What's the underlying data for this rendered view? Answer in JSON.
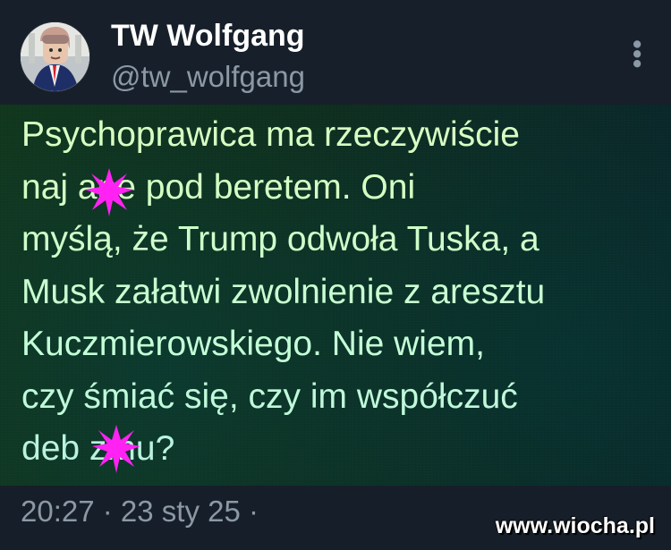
{
  "author": {
    "name": "TW Wolfgang",
    "handle": "@tw_wolfgang"
  },
  "post": {
    "lines": [
      "Psychoprawica ma rzeczywiście",
      "naj    ane pod beretem. Oni",
      "myślą, że Trump odwoła Tuska, a",
      "Musk załatwi zwolnienie z aresztu",
      "Kuczmierowskiego. Nie wiem,",
      "czy śmiać się, czy im współczuć",
      "deb    zmu?"
    ],
    "censor_marks": [
      "magenta-star-censor-icon",
      "magenta-star-censor-icon"
    ]
  },
  "meta": {
    "timestamp": "20:27 · 23 sty 25 ·"
  },
  "watermark": "www.wiocha.pl",
  "icons": {
    "more": "more-vertical-icon",
    "avatar": "profile-avatar-icon"
  },
  "colors": {
    "background": "#161f29",
    "muted_text": "#8b98a5",
    "censor": "#ff20f2",
    "post_text": "#d6ffc8"
  }
}
